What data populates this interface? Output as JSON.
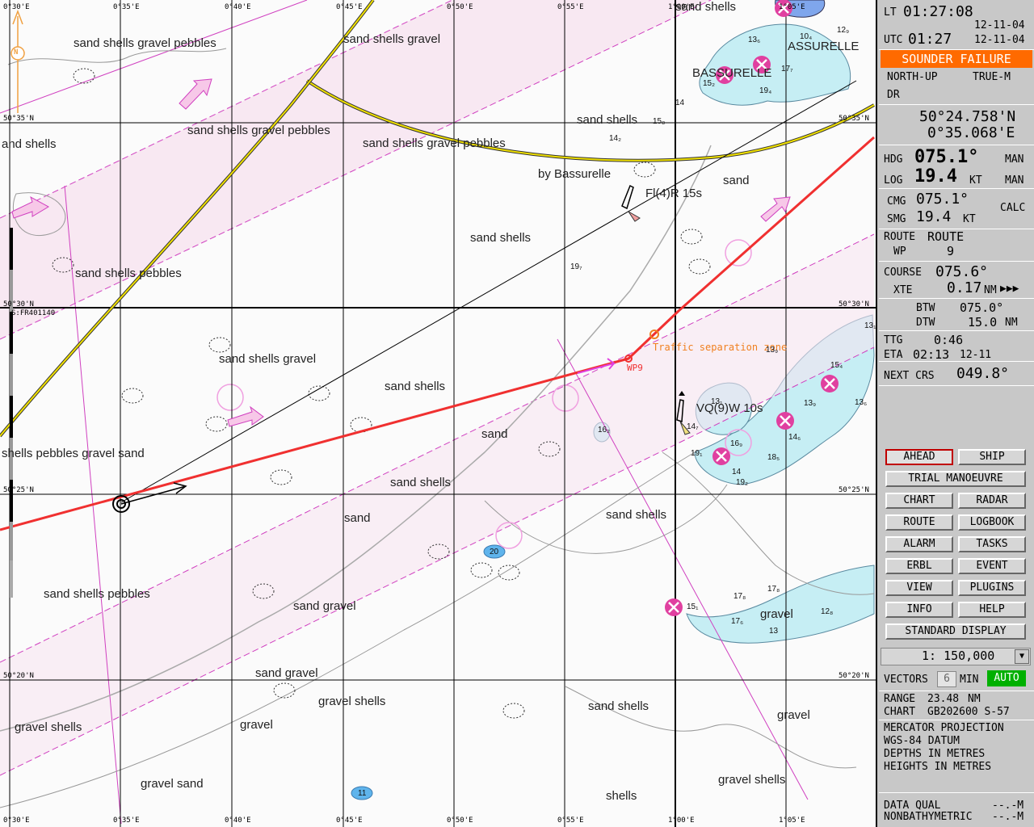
{
  "panel": {
    "lt_label": "LT",
    "lt_time": "01:27:08",
    "lt_date": "12-11-04",
    "utc_label": "UTC",
    "utc_time": "01:27",
    "utc_date": "12-11-04",
    "alarm": "SOUNDER FAILURE",
    "orientation": "NORTH-UP",
    "motion": "TRUE-M",
    "pos_mode": "DR",
    "lat": "50°24.758'N",
    "lon": "0°35.068'E",
    "hdg_label": "HDG",
    "hdg_value": "075.1°",
    "hdg_src": "MAN",
    "log_label": "LOG",
    "log_value": "19.4",
    "log_unit": "KT",
    "log_src": "MAN",
    "cmg_label": "CMG",
    "cmg_value": "075.1°",
    "smg_label": "SMG",
    "smg_value": "19.4",
    "smg_unit": "KT",
    "calc": "CALC",
    "route_label": "ROUTE",
    "route_value": "ROUTE",
    "wp_label": "WP",
    "wp_value": "9",
    "course_label": "COURSE",
    "course_value": "075.6°",
    "xte_label": "XTE",
    "xte_value": "0.17",
    "xte_unit": "NM",
    "xte_dir": "▶▶▶",
    "btw_label": "BTW",
    "btw_value": "075.0°",
    "dtw_label": "DTW",
    "dtw_value": "15.0",
    "dtw_unit": "NM",
    "ttg_label": "TTG",
    "ttg_value": "0:46",
    "eta_label": "ETA",
    "eta_value": "02:13",
    "eta_date": "12-11",
    "next_label": "NEXT CRS",
    "next_value": "049.8°",
    "buttons": {
      "ahead": "AHEAD",
      "ship": "SHIP",
      "trial": "TRIAL MANOEUVRE",
      "chart": "CHART",
      "radar": "RADAR",
      "route": "ROUTE",
      "logbook": "LOGBOOK",
      "alarm": "ALARM",
      "tasks": "TASKS",
      "erbl": "ERBL",
      "event": "EVENT",
      "view": "VIEW",
      "plugins": "PLUGINS",
      "info": "INFO",
      "help": "HELP",
      "standard": "STANDARD DISPLAY"
    },
    "scale": "1: 150,000",
    "vectors_label": "VECTORS",
    "vectors_value": "6",
    "vectors_unit": "MIN",
    "vectors_mode": "AUTO",
    "range_label": "RANGE",
    "range_value": "23.48",
    "range_unit": "NM",
    "chart_label": "CHART",
    "chart_value": "GB202600 S-57",
    "info_lines": [
      "MERCATOR PROJECTION",
      "WGS-84 DATUM",
      "DEPTHS IN METRES",
      "HEIGHTS IN METRES"
    ],
    "dq_label": "DATA QUAL",
    "dq_value": "--.-M",
    "nb_label": "NONBATHYMETRIC",
    "nb_value": "--.-M"
  },
  "chart": {
    "lon_labels": [
      "0°30'E",
      "0°35'E",
      "0°40'E",
      "0°45'E",
      "0°50'E",
      "0°55'E",
      "1°00'E",
      "1°05'E"
    ],
    "lat_labels": [
      "50°35'N",
      "50°30'N",
      "50°25'N",
      "50°20'N"
    ],
    "chart_id": "S:FR401140",
    "wp_label": "WP9",
    "tss_label": "Traffic separation zone",
    "light1": "Fl(4)R 15s",
    "light2": "VQ(9)W 10s",
    "names": [
      "BASSURELLE",
      "ASSURELLE",
      "by Bassurelle"
    ],
    "seabed": [
      "sand shells gravel pebbles",
      "sand shells gravel",
      "sand shells",
      "sand shells gravel pebbles",
      "and shells",
      "sand shells gravel pebbles",
      "sand shells",
      "sand",
      "sand shells",
      "sand shells pebbles",
      "sand shells gravel",
      "sand shells",
      "sand",
      "shells pebbles gravel sand",
      "sand shells",
      "sand",
      "sand shells",
      "sand shells pebbles",
      "sand gravel",
      "sand gravel",
      "gravel shells",
      "gravel",
      "gravel shells",
      "sand shells",
      "gravel",
      "gravel sand",
      "gravel shells",
      "shells",
      "gravel",
      "sand shells"
    ],
    "depths": [
      "13₆",
      "10₄",
      "12₉",
      "15₂",
      "17₇",
      "19₄",
      "14",
      "15₈",
      "14₂",
      "19₇",
      "13₉",
      "15₄",
      "13₁",
      "13₆",
      "13₉",
      "13₁",
      "14₇",
      "16₉",
      "18₅",
      "14₆",
      "16₂",
      "19₁",
      "14",
      "19₂",
      "17₈",
      "17₈",
      "12₈",
      "15₁",
      "17₆",
      "13",
      "20",
      "11"
    ],
    "orientation_mark": "N"
  }
}
